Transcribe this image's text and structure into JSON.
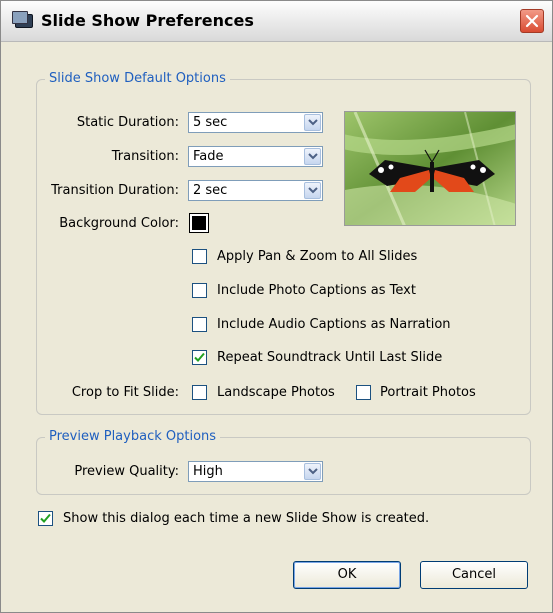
{
  "window": {
    "title": "Slide Show Preferences"
  },
  "default_options": {
    "group_title": "Slide Show Default Options",
    "static_duration": {
      "label": "Static Duration:",
      "value": "5 sec"
    },
    "transition": {
      "label": "Transition:",
      "value": "Fade"
    },
    "transition_duration": {
      "label": "Transition Duration:",
      "value": "2 sec"
    },
    "background_color": {
      "label": "Background Color:",
      "color": "#000000"
    },
    "checkboxes": [
      {
        "label": "Apply Pan & Zoom to All Slides",
        "checked": false
      },
      {
        "label": "Include Photo Captions as Text",
        "checked": false
      },
      {
        "label": "Include Audio Captions as Narration",
        "checked": false
      },
      {
        "label": "Repeat Soundtrack Until Last Slide",
        "checked": true
      }
    ],
    "crop": {
      "label": "Crop to Fit Slide:",
      "landscape": {
        "label": "Landscape Photos",
        "checked": false
      },
      "portrait": {
        "label": "Portrait Photos",
        "checked": false
      }
    }
  },
  "preview_options": {
    "group_title": "Preview Playback Options",
    "quality": {
      "label": "Preview Quality:",
      "value": "High"
    }
  },
  "show_dialog": {
    "label": "Show this dialog each time a new Slide Show is created.",
    "checked": true
  },
  "buttons": {
    "ok": "OK",
    "cancel": "Cancel"
  },
  "colors": {
    "group_title": "#1f5fbf",
    "checkmark": "#21a121",
    "close": "#d94b32"
  }
}
